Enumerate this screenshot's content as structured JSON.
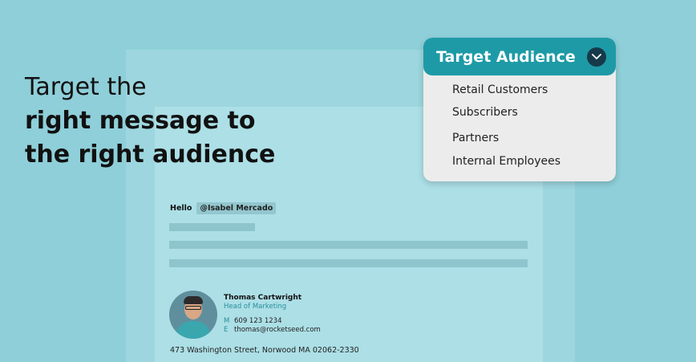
{
  "headline": {
    "line1": "Target the",
    "line2": "right message to",
    "line3": "the right audience"
  },
  "email": {
    "greeting": "Hello",
    "mention": "@Isabel Mercado",
    "signature": {
      "name": "Thomas Cartwright",
      "role": "Head of Marketing",
      "mobile_label": "M",
      "mobile": "609 123 1234",
      "email_label": "E",
      "email": "thomas@rocketseed.com"
    },
    "address": "473 Washington Street, Norwood MA 02062-2330"
  },
  "dropdown": {
    "title": "Target Audience",
    "icon": "chevron-down-icon",
    "options": [
      "Retail Customers",
      "Subscribers",
      "Partners",
      "Internal Employees"
    ]
  },
  "colors": {
    "background": "#8ecfd9",
    "accent": "#1e9aa6",
    "chevron": "#163a4a"
  }
}
